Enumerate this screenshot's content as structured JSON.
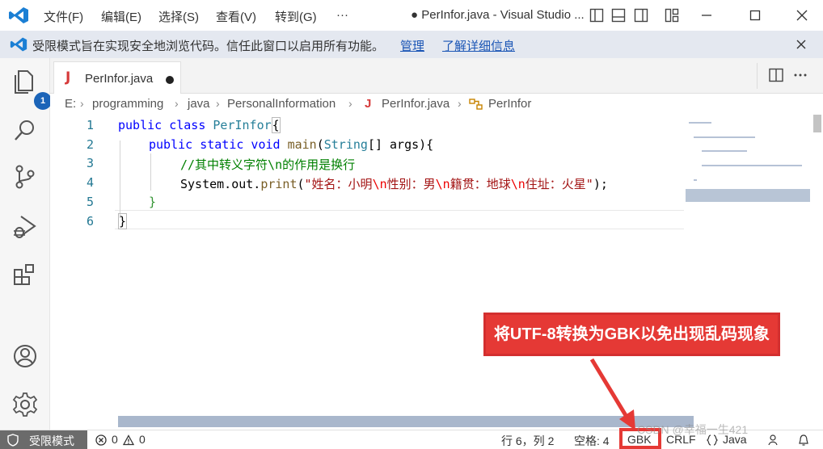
{
  "titlebar": {
    "menus": [
      "文件(F)",
      "编辑(E)",
      "选择(S)",
      "查看(V)",
      "转到(G)",
      "···"
    ],
    "title": "● PerInfor.java - Visual Studio ..."
  },
  "banner": {
    "text": "受限模式旨在实现安全地浏览代码。信任此窗口以启用所有功能。",
    "manage_link": "管理",
    "learn_link": "了解详细信息"
  },
  "activitybar": {
    "explorer_badge": "1"
  },
  "tab": {
    "icon": "J",
    "label": "PerInfor.java"
  },
  "breadcrumb": [
    "E:",
    "programming",
    "java",
    "PersonalInformation",
    "PerInfor.java",
    "PerInfor"
  ],
  "editor": {
    "line_numbers": [
      "1",
      "2",
      "3",
      "4",
      "5",
      "6"
    ],
    "lines": {
      "l1_kw": "public class ",
      "l1_name": "PerInfor",
      "l1_brace": "{",
      "l2_kw": "public static void ",
      "l2_fn": "main",
      "l2_paren": "(",
      "l2_type": "String",
      "l2_rest": "[] args){",
      "l3_comment": "//其中转义字符\\n的作用是换行",
      "l4_obj": "System.out.",
      "l4_fn": "print",
      "l4_open": "(",
      "l4_s1": "\"姓名：小明",
      "l4_e1": "\\n",
      "l4_s2": "性别：男",
      "l4_e2": "\\n",
      "l4_s3": "籍贯：地球",
      "l4_e3": "\\n",
      "l4_s4": "住址：火星\"",
      "l4_close": ");",
      "l5_brace": "}",
      "l6_brace": "}"
    }
  },
  "callout": {
    "text": "将UTF-8转换为GBK以免出现乱码现象"
  },
  "statusbar": {
    "restricted": "受限模式",
    "errors": "0",
    "warnings": "0",
    "position": "行 6，列 2",
    "spaces": "空格: 4",
    "encoding": "GBK",
    "eol": "CRLF",
    "language": "Java",
    "watermark": "CSDN @幸福一生421"
  },
  "colors": {
    "accent": "#1b64b8",
    "callout": "#e53935",
    "banner_bg": "#e4e8f0"
  }
}
